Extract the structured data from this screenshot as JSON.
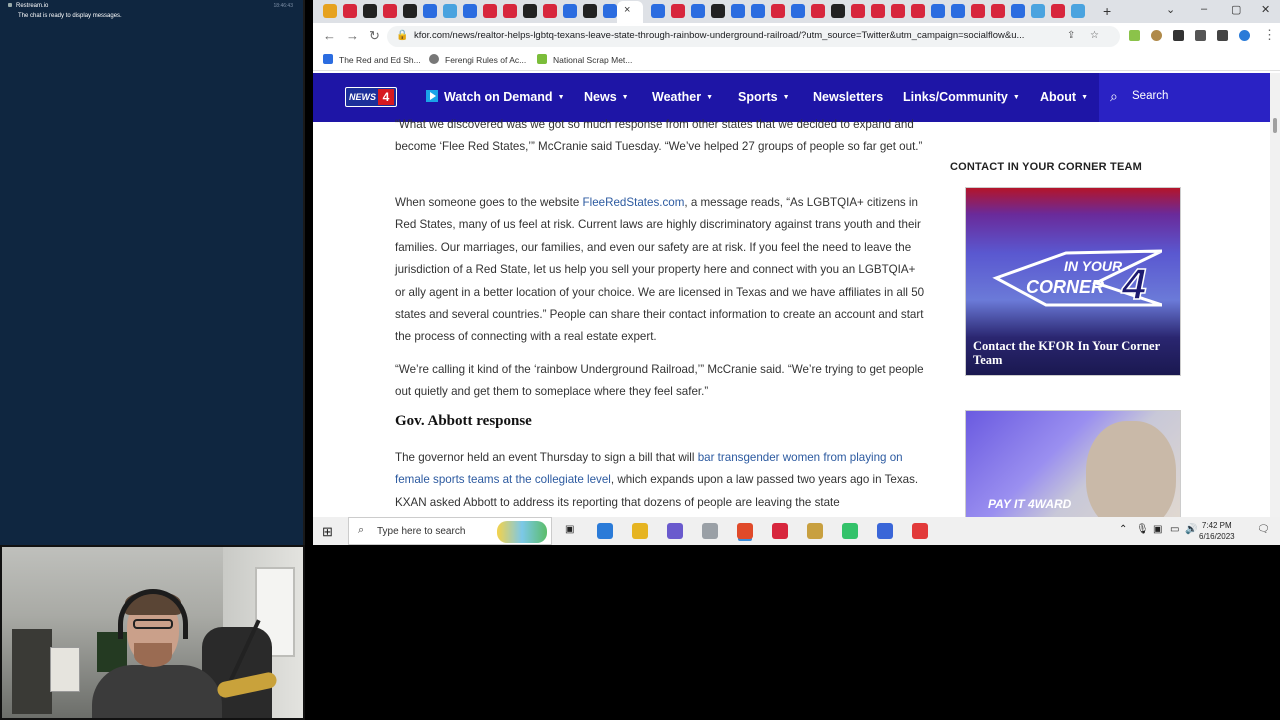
{
  "chat": {
    "channel": "Restream.io",
    "time": "18:46:43",
    "message": "The chat is ready to display messages."
  },
  "browser": {
    "url": "kfor.com/news/realtor-helps-lgbtq-texans-leave-state-through-rainbow-underground-railroad/?utm_source=Twitter&utm_campaign=socialflow&u...",
    "active_tab_close": "×",
    "new_tab": "+",
    "bookmarks": [
      {
        "label": "The Red and Ed Sh...",
        "color": "#2b6ce0"
      },
      {
        "label": "Ferengi Rules of Ac...",
        "color": "#777777"
      },
      {
        "label": "National Scrap Met...",
        "color": "#7bbd3a"
      }
    ],
    "tab_colors": [
      "#e6a220",
      "#d7263d",
      "#222222",
      "#d7263d",
      "#222222",
      "#2b6ce0",
      "#4aa3df",
      "#2b6ce0",
      "#d7263d",
      "#d7263d",
      "#222222",
      "#d7263d",
      "#2b6ce0",
      "#222222",
      "#2b6ce0",
      "#2b6ce0",
      "#d7263d",
      "#2b6ce0",
      "#222222",
      "#2b6ce0",
      "#2b6ce0",
      "#d7263d",
      "#2b6ce0",
      "#d7263d",
      "#222222",
      "#d7263d",
      "#d7263d",
      "#d7263d",
      "#d7263d",
      "#2b6ce0",
      "#2b6ce0",
      "#d7263d",
      "#d7263d",
      "#2b6ce0",
      "#4aa3df",
      "#d7263d",
      "#4aa3df",
      "#4aa3df",
      "#222222",
      "#222222"
    ]
  },
  "site": {
    "logo_text": "NEWS",
    "logo_number": "4",
    "nav": [
      {
        "label": "Watch on Demand",
        "dropdown": true
      },
      {
        "label": "News",
        "dropdown": true
      },
      {
        "label": "Weather",
        "dropdown": true
      },
      {
        "label": "Sports",
        "dropdown": true
      },
      {
        "label": "Newsletters",
        "dropdown": false
      },
      {
        "label": "Links/Community",
        "dropdown": true
      },
      {
        "label": "About",
        "dropdown": true
      }
    ],
    "search_label": "Search"
  },
  "article": {
    "p1": "“What we discovered was we got so much response from other states that we decided to expand and become ‘Flee Red States,’” McCranie said Tuesday. “We’ve helped 27 groups of people so far get out.”",
    "p2_before": "When someone goes to the website ",
    "p2_link": "FleeRedStates.com",
    "p2_after": ", a message reads, “As LGBTQIA+ citizens in Red States, many of us feel at risk. Current laws are highly discriminatory against trans youth and their families. Our marriages, our families, and even our safety are at risk. If you feel the need to leave the jurisdiction of a Red State, let us help you sell your property here and connect with you an LGBTQIA+ or ally agent in a better location of your choice. We are licensed in Texas and we have affiliates in all 50 states and several countries.” People can share their contact information to create an account and start the process of connecting with a real estate expert.",
    "p3": "“We’re calling it kind of the ‘rainbow Underground Railroad,’” McCranie said. “We’re trying to get people out quietly and get them to someplace where they feel safer.”",
    "heading": "Gov. Abbott response",
    "p4_before": "The governor held an event Thursday to sign a bill that will ",
    "p4_link": "bar transgender women from playing on female sports teams at the collegiate level",
    "p4_after": ", which expands upon a law passed two years ago in Texas. KXAN asked Abbott to address its reporting that dozens of people are leaving the state"
  },
  "sidebar": {
    "title": "CONTACT IN YOUR CORNER TEAM",
    "promo1_logo_top": "IN YOUR",
    "promo1_logo_bottom": "CORNER",
    "promo1_logo_number": "4",
    "promo1_caption": "Contact the KFOR In Your Corner Team",
    "promo2_text": "PAY IT 4WARD"
  },
  "taskbar": {
    "search_placeholder": "Type here to search",
    "time": "7:42 PM",
    "date": "6/16/2023",
    "apps": [
      "#2b7bd8",
      "#e6b422",
      "#6a5acd",
      "#9aa0a6",
      "#e04a2a",
      "#d7263d",
      "#c8a040",
      "#33c26a",
      "#3a66d8",
      "#e23a3a"
    ]
  }
}
